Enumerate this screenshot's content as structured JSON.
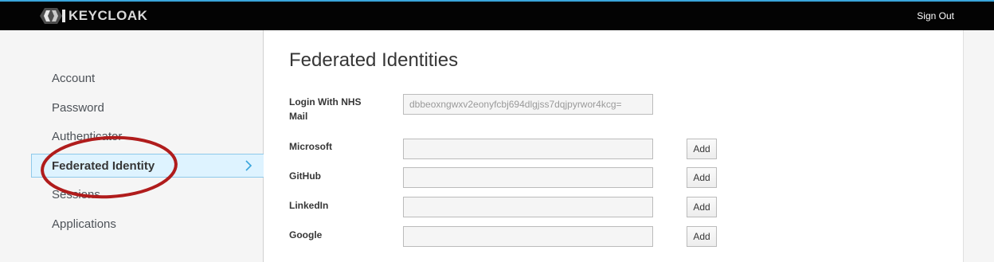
{
  "header": {
    "logo_text": "KEYCLOAK",
    "signout_label": "Sign Out"
  },
  "sidebar": {
    "items": [
      {
        "label": "Account"
      },
      {
        "label": "Password"
      },
      {
        "label": "Authenticator"
      },
      {
        "label": "Federated Identity",
        "active": true
      },
      {
        "label": "Sessions"
      },
      {
        "label": "Applications"
      }
    ]
  },
  "main": {
    "title": "Federated Identities",
    "rows": [
      {
        "label": "Login With NHS Mail",
        "value": "dbbeoxngwxv2eonyfcbj694dlgjss7dqjpyrwor4kcg=",
        "button": ""
      },
      {
        "label": "Microsoft",
        "value": "",
        "button": "Add"
      },
      {
        "label": "GitHub",
        "value": "",
        "button": "Add"
      },
      {
        "label": "LinkedIn",
        "value": "",
        "button": "Add"
      },
      {
        "label": "Google",
        "value": "",
        "button": "Add"
      }
    ]
  },
  "colors": {
    "topbar": "#030303",
    "active_nav_bg": "#def3ff",
    "active_nav_border": "#8ec9ea",
    "annotation_ring": "#b01c1c"
  }
}
